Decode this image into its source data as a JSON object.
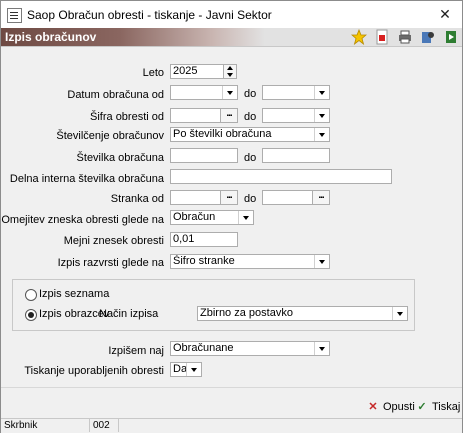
{
  "window": {
    "title": "Saop Obračun obresti - tiskanje - Javni Sektor",
    "close": "✕"
  },
  "header": {
    "title": "Izpis obračunov"
  },
  "toolbar": {
    "icons": [
      "star-icon",
      "pdf-icon",
      "printer-icon",
      "export-icon",
      "exit-icon"
    ]
  },
  "form": {
    "leto": {
      "label": "Leto",
      "value": "2025"
    },
    "datum": {
      "label": "Datum obračuna od",
      "from": "",
      "to_label": "do",
      "to": ""
    },
    "sifra": {
      "label": "Šifra obresti od",
      "from": "",
      "to_label": "do",
      "to": ""
    },
    "stevilcenje": {
      "label": "Številčenje obračunov",
      "value": "Po številki obračuna"
    },
    "stevilka": {
      "label": "Številka obračuna",
      "from": "",
      "to_label": "do",
      "to": ""
    },
    "delna": {
      "label": "Delna interna številka obračuna",
      "value": ""
    },
    "stranka": {
      "label": "Stranka od",
      "from": "",
      "to_label": "do",
      "to": ""
    },
    "omejitev": {
      "label": "Omejitev zneska obresti glede na",
      "value": "Obračun"
    },
    "mejni": {
      "label": "Mejni znesek obresti",
      "value": "0,01"
    },
    "razvrsti": {
      "label": "Izpis razvrsti glede na",
      "value": "Šifro stranke"
    },
    "izpis_type": {
      "option1": "Izpis seznama",
      "option2": "Izpis obrazcev",
      "nacin_label": "Način izpisa",
      "nacin_value": "Zbirno za postavko"
    },
    "izpisem": {
      "label": "Izpišem naj",
      "value": "Obračunane"
    },
    "tiskanje": {
      "label": "Tiskanje uporabljenih obresti",
      "value": "Da"
    }
  },
  "buttons": {
    "cancel": "Opusti",
    "print": "Tiskaj"
  },
  "status": {
    "user": "Skrbnik",
    "code": "002"
  }
}
